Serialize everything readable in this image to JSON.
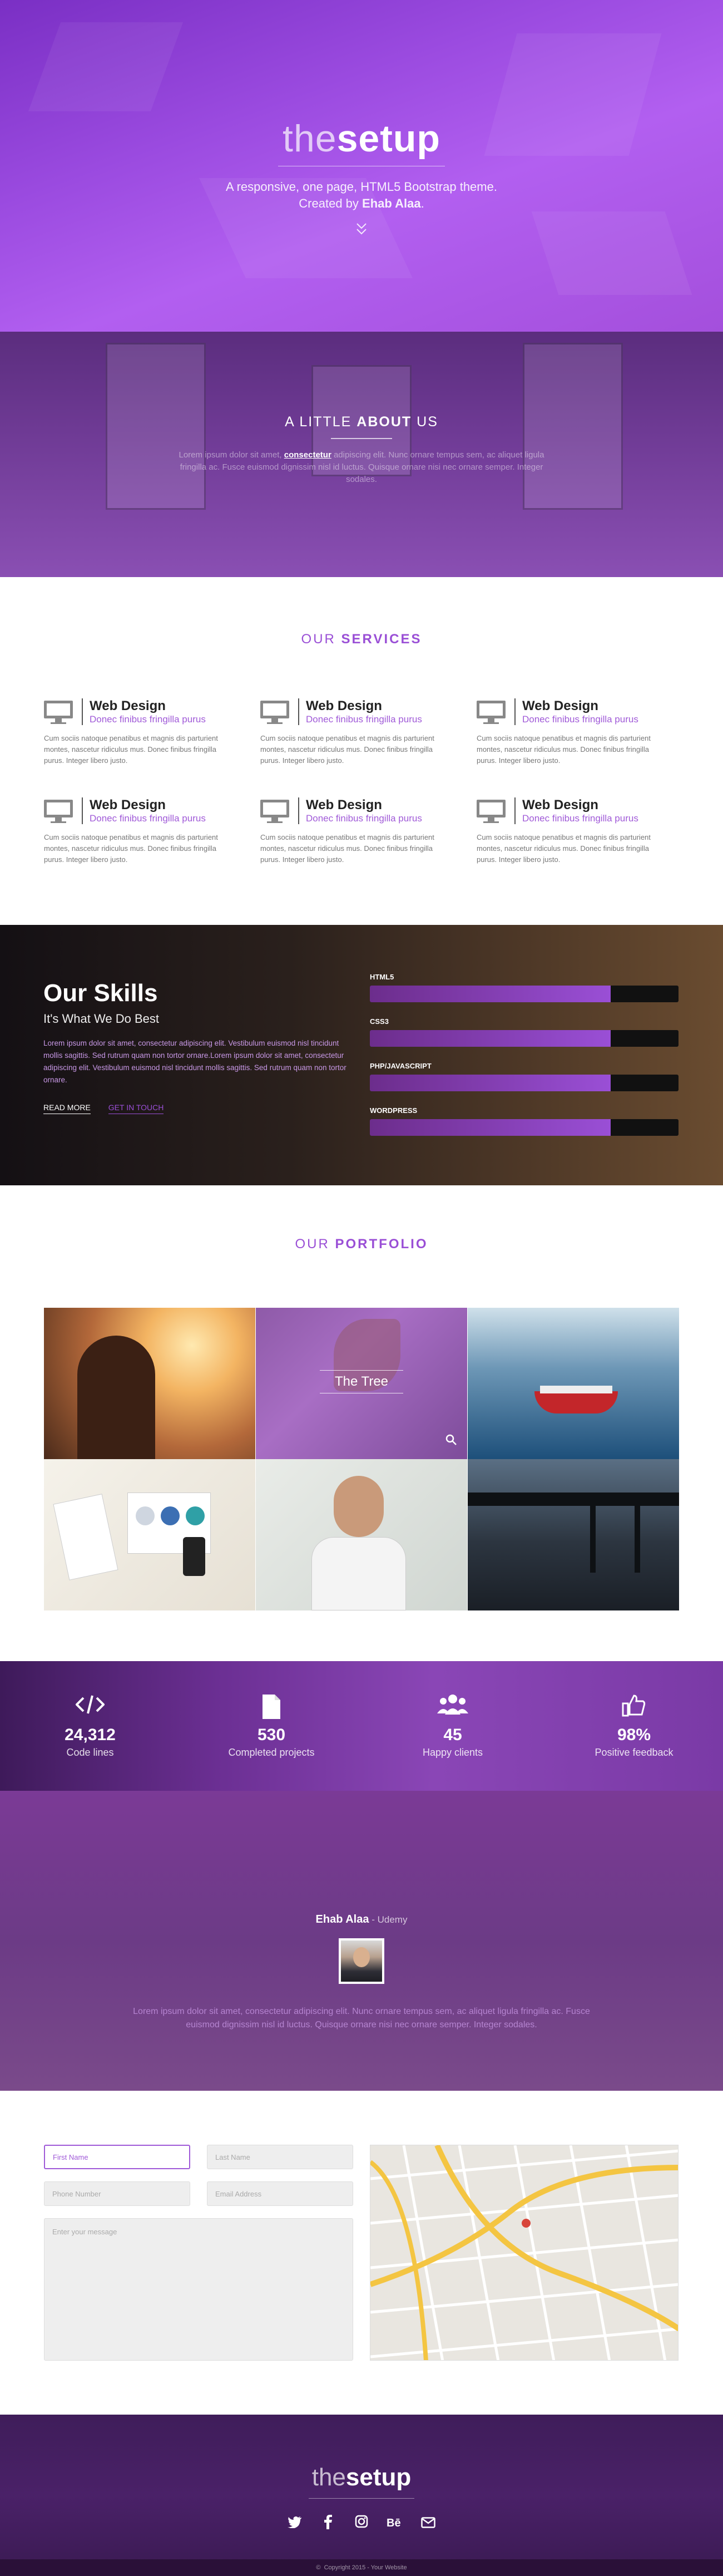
{
  "hero": {
    "logo_thin": "the",
    "logo_bold": "setup",
    "subtitle_line1": "A responsive, one page, HTML5 Bootstrap theme.",
    "subtitle_line2_prefix": "Created by ",
    "subtitle_author": "Ehab Alaa",
    "subtitle_line2_suffix": ".",
    "scroll_icon": "double-chevron-down-icon"
  },
  "about": {
    "title_light": "A LITTLE ",
    "title_bold": "ABOUT",
    "title_end": " US",
    "text_before": "Lorem ipsum dolor sit amet, ",
    "text_highlight": "consectetur",
    "text_after": " adipiscing elit. Nunc ornare tempus sem, ac aliquet ligula fringilla ac. Fusce euismod dignissim nisl id luctus. Quisque ornare nisi nec ornare semper. Integer sodales."
  },
  "services": {
    "title_light": "OUR ",
    "title_bold": "SERVICES",
    "items": [
      {
        "icon": "monitor-icon",
        "title": "Web Design",
        "subtitle": "Donec finibus fringilla purus",
        "text": "Cum sociis natoque penatibus et magnis dis parturient montes, nascetur ridiculus mus. Donec finibus fringilla purus. Integer libero justo."
      },
      {
        "icon": "monitor-icon",
        "title": "Web Design",
        "subtitle": "Donec finibus fringilla purus",
        "text": "Cum sociis natoque penatibus et magnis dis parturient montes, nascetur ridiculus mus. Donec finibus fringilla purus. Integer libero justo."
      },
      {
        "icon": "monitor-icon",
        "title": "Web Design",
        "subtitle": "Donec finibus fringilla purus",
        "text": "Cum sociis natoque penatibus et magnis dis parturient montes, nascetur ridiculus mus. Donec finibus fringilla purus. Integer libero justo."
      },
      {
        "icon": "monitor-icon",
        "title": "Web Design",
        "subtitle": "Donec finibus fringilla purus",
        "text": "Cum sociis natoque penatibus et magnis dis parturient montes, nascetur ridiculus mus. Donec finibus fringilla purus. Integer libero justo."
      },
      {
        "icon": "monitor-icon",
        "title": "Web Design",
        "subtitle": "Donec finibus fringilla purus",
        "text": "Cum sociis natoque penatibus et magnis dis parturient montes, nascetur ridiculus mus. Donec finibus fringilla purus. Integer libero justo."
      },
      {
        "icon": "monitor-icon",
        "title": "Web Design",
        "subtitle": "Donec finibus fringilla purus",
        "text": "Cum sociis natoque penatibus et magnis dis parturient montes, nascetur ridiculus mus. Donec finibus fringilla purus. Integer libero justo."
      }
    ]
  },
  "skills": {
    "title": "Our Skills",
    "subtitle": "It's What We Do Best",
    "text": "Lorem ipsum dolor sit amet, consectetur adipiscing elit. Vestibulum euismod nisl tincidunt mollis sagittis. Sed rutrum quam non tortor ornare.Lorem ipsum dolor sit amet, consectetur adipiscing elit. Vestibulum euismod nisl tincidunt mollis sagittis. Sed rutrum quam non tortor ornare.",
    "read_more": "READ MORE",
    "get_in_touch": "GET IN TOUCH",
    "bars": [
      {
        "label": "HTML5",
        "level": 0.78
      },
      {
        "label": "CSS3",
        "level": 0.78
      },
      {
        "label": "PHP/JAVASCRIPT",
        "level": 0.78
      },
      {
        "label": "WORDPRESS",
        "level": 0.78
      }
    ]
  },
  "portfolio": {
    "title_light": "OUR ",
    "title_bold": "PORTFOLIO",
    "hover_caption": "The Tree",
    "search_icon": "search-icon"
  },
  "stats": [
    {
      "icon": "code-icon",
      "number": "24,312",
      "label": "Code lines"
    },
    {
      "icon": "file-icon",
      "number": "530",
      "label": "Completed projects"
    },
    {
      "icon": "users-icon",
      "number": "45",
      "label": "Happy clients"
    },
    {
      "icon": "thumbs-up-icon",
      "number": "98%",
      "label": "Positive feedback"
    }
  ],
  "testimonial": {
    "name": "Ehab Alaa",
    "company": " - Udemy",
    "text": "Lorem ipsum dolor sit amet, consectetur adipiscing elit. Nunc ornare tempus sem, ac aliquet ligula fringilla ac. Fusce euismod dignissim nisl id luctus. Quisque ornare nisi nec ornare semper. Integer sodales."
  },
  "contact": {
    "first_name": "First Name",
    "last_name": "Last Name",
    "phone": "Phone Number",
    "email": "Email Address",
    "message": "Enter your message"
  },
  "footer": {
    "logo_thin": "the",
    "logo_bold": "setup",
    "social": [
      "twitter-icon",
      "facebook-icon",
      "instagram-icon",
      "behance-icon",
      "mail-icon"
    ],
    "copyright": "Copyright 2015 - Your Website"
  },
  "colors": {
    "accent": "#9a4fd6",
    "footer_bg": "#3f1d5a"
  }
}
